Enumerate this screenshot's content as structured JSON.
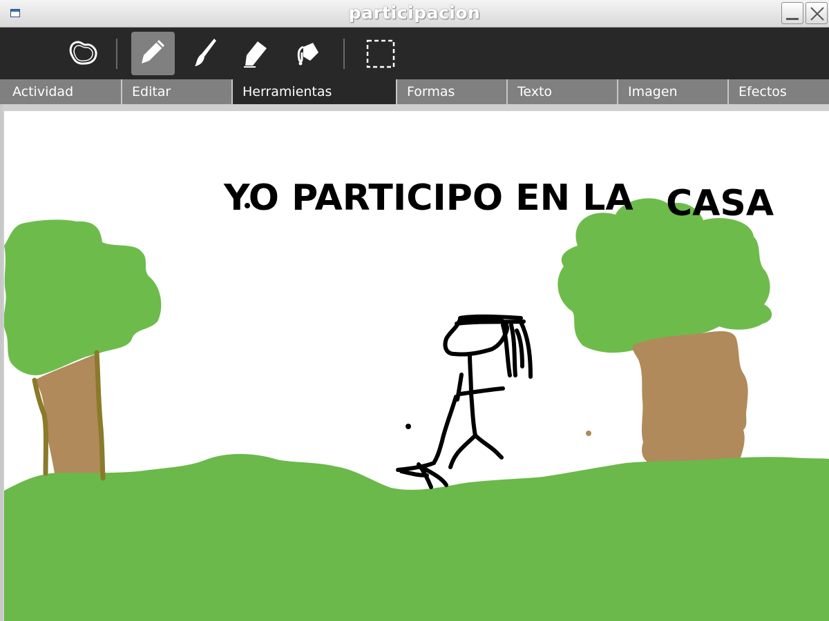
{
  "window": {
    "title": "participacion"
  },
  "toolbar": {
    "tools": [
      {
        "name": "freeform-shape",
        "icon": "blob-outline-icon",
        "active": false
      },
      {
        "name": "pencil",
        "icon": "pencil-icon",
        "active": true
      },
      {
        "name": "brush",
        "icon": "brush-icon",
        "active": false
      },
      {
        "name": "eraser",
        "icon": "eraser-icon",
        "active": false
      },
      {
        "name": "bucket",
        "icon": "paint-bucket-icon",
        "active": false
      },
      {
        "name": "select",
        "icon": "dashed-selection-icon",
        "active": false
      }
    ]
  },
  "tabs": [
    {
      "label": "Actividad",
      "active": false
    },
    {
      "label": "Editar",
      "active": false
    },
    {
      "label": "Herramientas",
      "active": true
    },
    {
      "label": "Formas",
      "active": false
    },
    {
      "label": "Texto",
      "active": false
    },
    {
      "label": "Imagen",
      "active": false
    },
    {
      "label": "Efectos",
      "active": false
    }
  ],
  "drawing": {
    "text_main": "YO PARTICIPO EN LA",
    "text_second": "CASA",
    "colors": {
      "grass": "#6ab94a",
      "foliage": "#6dbc4b",
      "trunk": "#b08a5a",
      "trunk_outline": "#8a7a2a",
      "ink": "#000000"
    }
  }
}
